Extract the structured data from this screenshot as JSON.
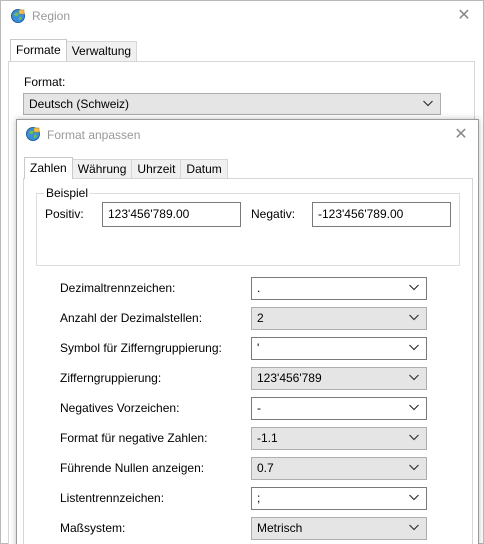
{
  "region_window": {
    "title": "Region",
    "tabs": [
      {
        "label": "Formate",
        "active": true
      },
      {
        "label": "Verwaltung",
        "active": false
      }
    ],
    "format_label": "Format:",
    "format_value": "Deutsch (Schweiz)"
  },
  "format_dialog": {
    "title": "Format anpassen",
    "tabs": [
      {
        "label": "Zahlen",
        "active": true
      },
      {
        "label": "Währung",
        "active": false
      },
      {
        "label": "Uhrzeit",
        "active": false
      },
      {
        "label": "Datum",
        "active": false
      }
    ],
    "example": {
      "legend": "Beispiel",
      "positive_label": "Positiv:",
      "positive_value": "123'456'789.00",
      "negative_label": "Negativ:",
      "negative_value": "-123'456'789.00"
    },
    "settings": [
      {
        "label": "Dezimaltrennzeichen:",
        "value": ".",
        "editable": true
      },
      {
        "label": "Anzahl der Dezimalstellen:",
        "value": "2",
        "editable": false
      },
      {
        "label": "Symbol für Zifferngruppierung:",
        "value": "'",
        "editable": true
      },
      {
        "label": "Zifferngruppierung:",
        "value": "123'456'789",
        "editable": false
      },
      {
        "label": "Negatives Vorzeichen:",
        "value": "-",
        "editable": true
      },
      {
        "label": "Format für negative Zahlen:",
        "value": "-1.1",
        "editable": false
      },
      {
        "label": "Führende Nullen anzeigen:",
        "value": "0.7",
        "editable": false
      },
      {
        "label": "Listentrennzeichen:",
        "value": ";",
        "editable": true
      },
      {
        "label": "Maßsystem:",
        "value": "Metrisch",
        "editable": false
      }
    ]
  },
  "icons": {
    "app": "region-globe-icon",
    "close": "close-icon",
    "dropdown": "chevron-down-icon"
  },
  "colors": {
    "title_text": "#999999",
    "list_combo_bg": "#e5e5e5",
    "tab_inactive_bg": "#f0f0f0"
  }
}
